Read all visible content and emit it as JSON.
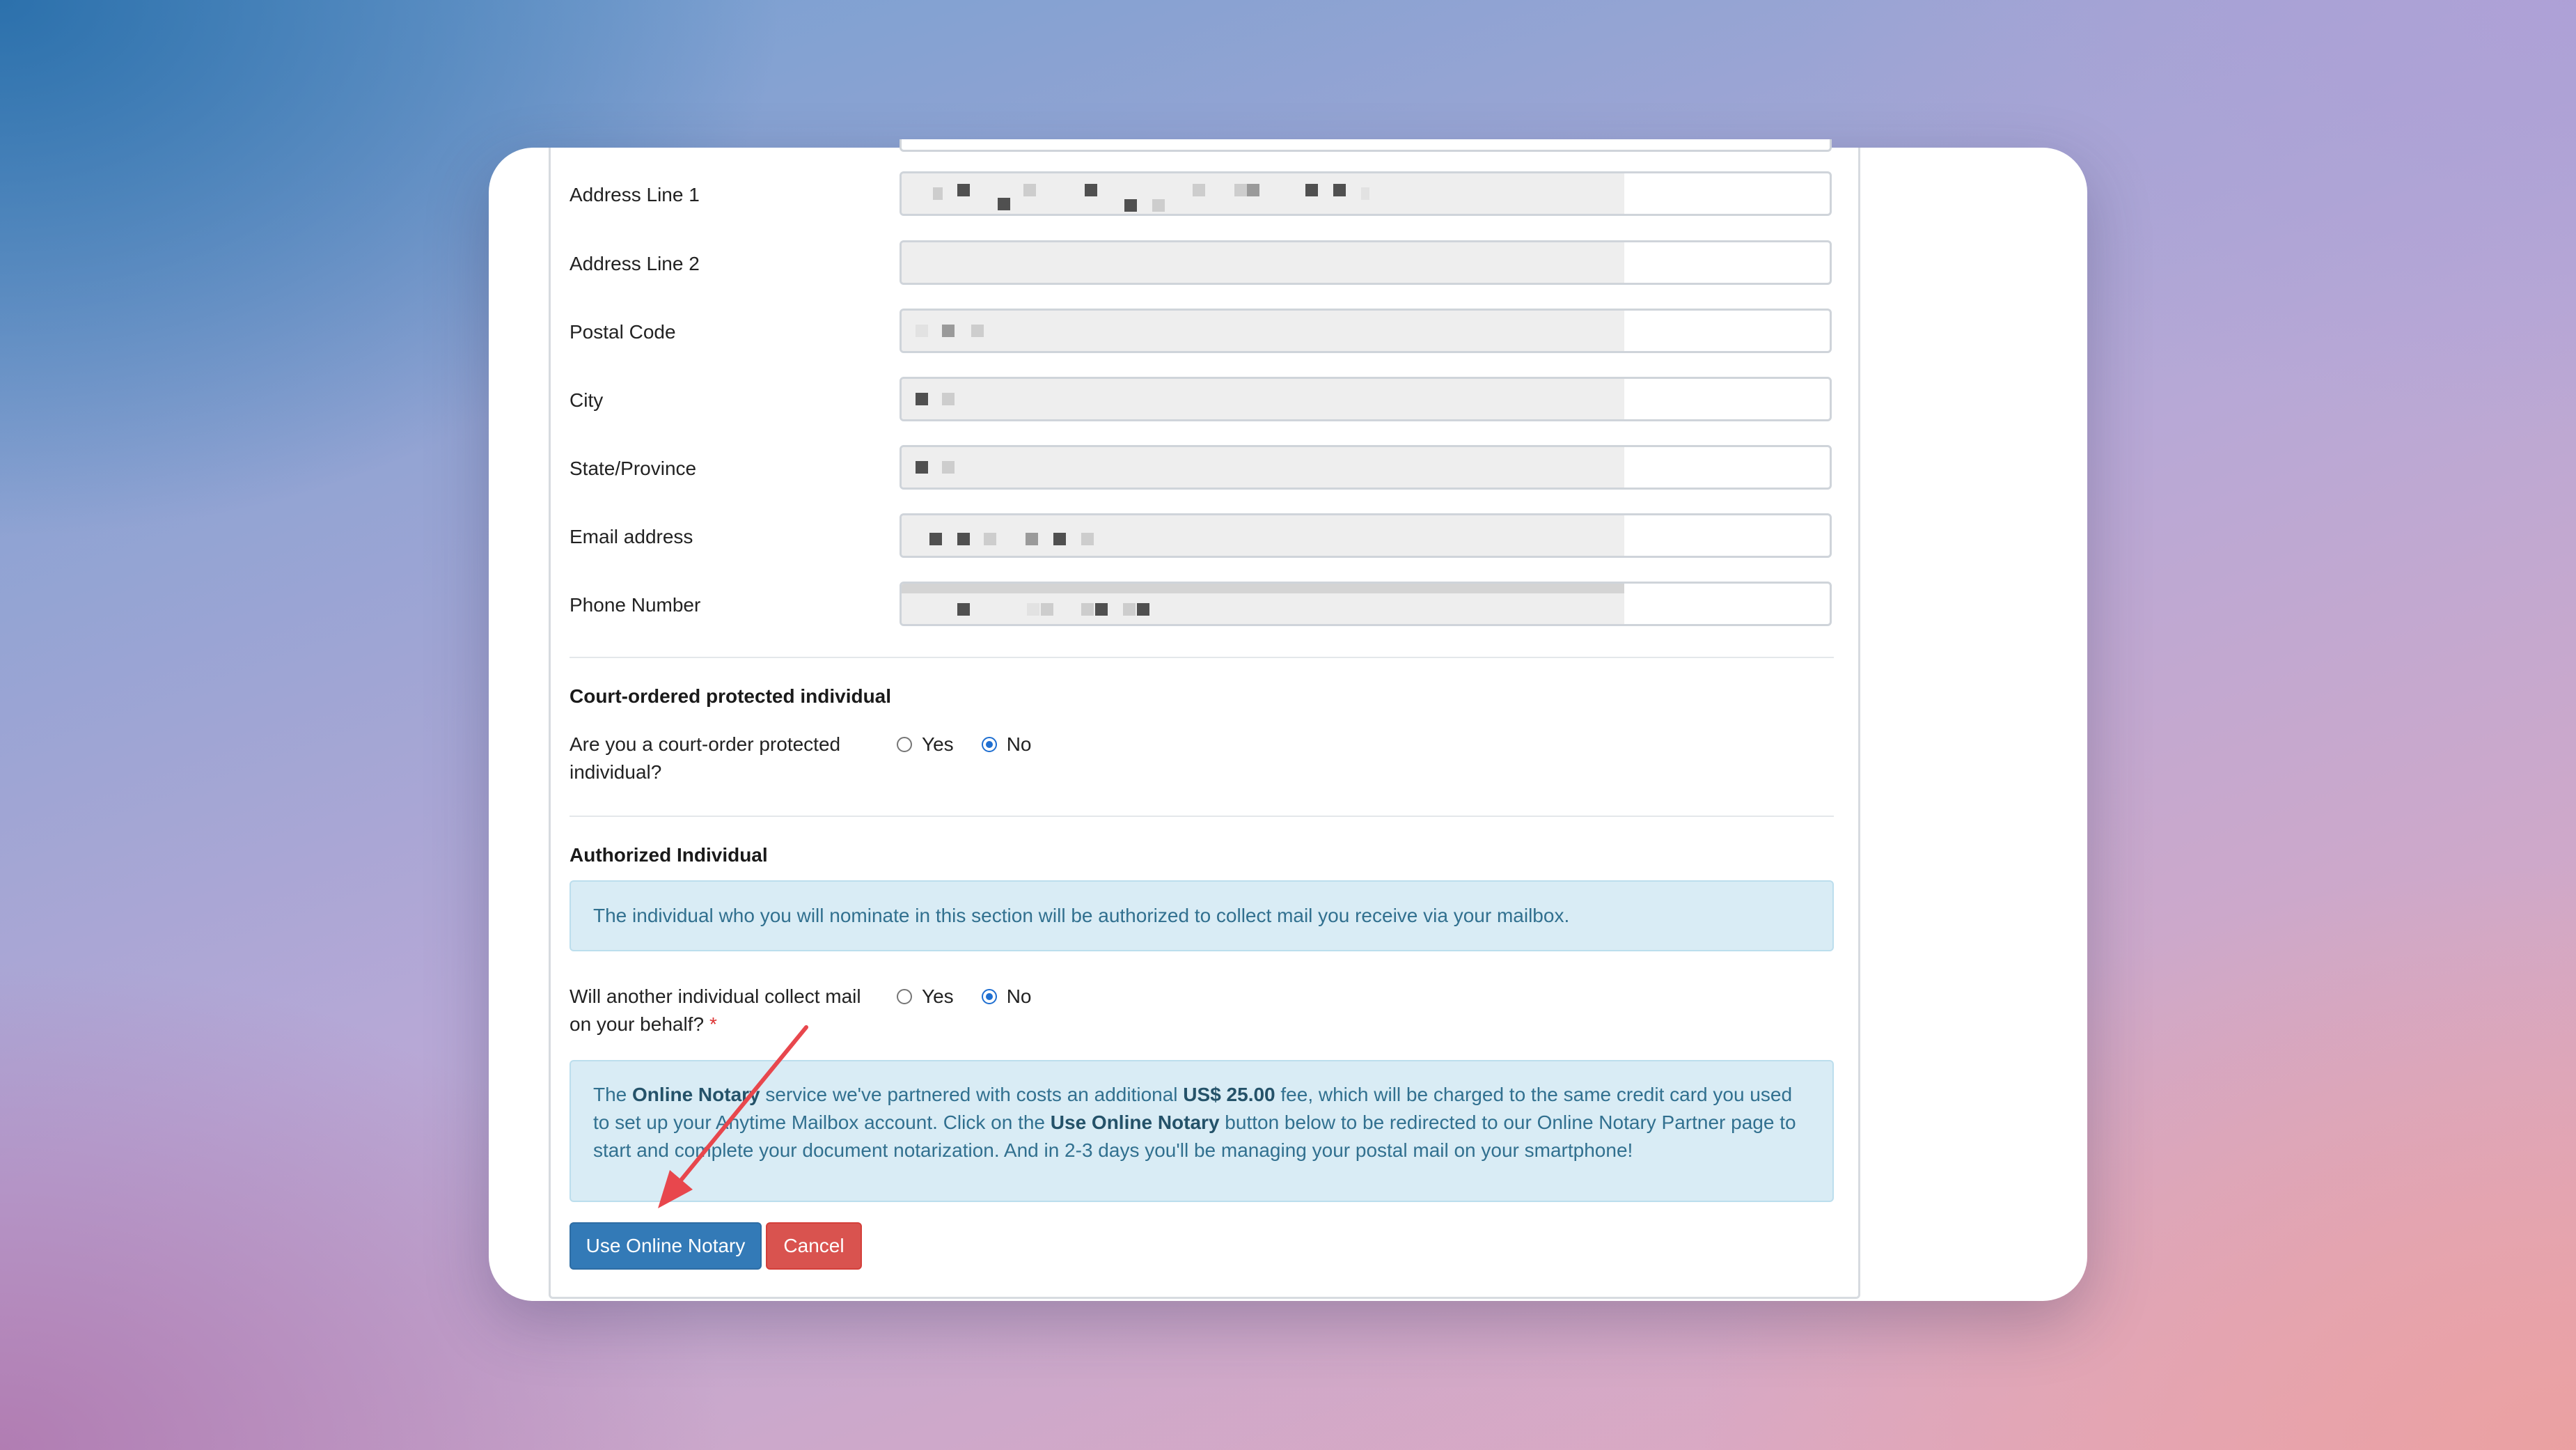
{
  "form": {
    "fields": [
      {
        "label": "Address Line 1",
        "value": ""
      },
      {
        "label": "Address Line 2",
        "value": ""
      },
      {
        "label": "Postal Code",
        "value": ""
      },
      {
        "label": "City",
        "value": ""
      },
      {
        "label": "State/Province",
        "value": ""
      },
      {
        "label": "Email address",
        "value": ""
      },
      {
        "label": "Phone Number",
        "value": ""
      }
    ],
    "court_section": {
      "heading": "Court-ordered protected individual",
      "question": "Are you a court-order protected individual?",
      "options": [
        "Yes",
        "No"
      ],
      "selected": "No"
    },
    "authorized_section": {
      "heading": "Authorized Individual",
      "info": "The individual who you will nominate in this section will be authorized to collect mail you receive via your mailbox.",
      "question": "Will another individual collect mail on your behalf?",
      "required_marker": "*",
      "options": [
        "Yes",
        "No"
      ],
      "selected": "No"
    },
    "notary_info": {
      "p1": "The ",
      "b1": "Online Notary",
      "p2": " service we've partnered with costs an additional ",
      "b2": "US$ 25.00",
      "p3": " fee, which will be charged to the same credit card you used to set up your Anytime Mailbox account. Click on the ",
      "b3": "Use Online Notary",
      "p4": " button below to be redirected to our Online Notary Partner page to start and complete your document notarization. And in 2-3 days you'll be managing your postal mail on your smartphone!"
    },
    "buttons": {
      "primary": "Use Online Notary",
      "cancel": "Cancel"
    },
    "annotation_color": "#e8474d"
  }
}
